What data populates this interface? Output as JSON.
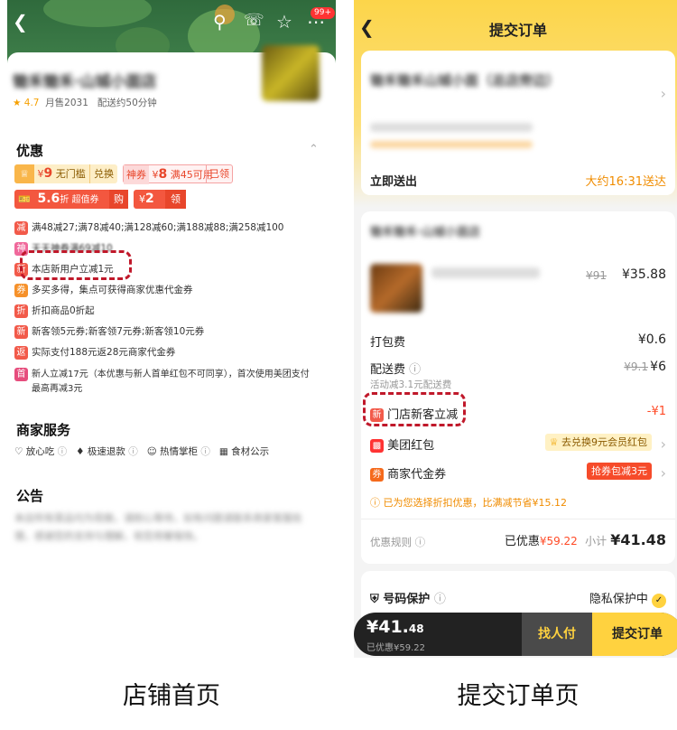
{
  "left": {
    "badge": "99+",
    "store_title": "锄禾锄禾·山城小面店",
    "rating": "4.7",
    "monthly_sales": "月售2031",
    "delivery_time": "配送约50分钟",
    "offers_title": "优惠",
    "coupon1_value": "9",
    "coupon1_desc": "无门槛",
    "coupon1_action": "兑换",
    "coupon2_tag": "神券",
    "coupon2_value": "8",
    "coupon2_desc": "满45可用",
    "coupon2_action": "已领",
    "coupon3_value": "5.6",
    "coupon3_desc": "折 超值券",
    "coupon3_action": "购",
    "coupon4_value": "2",
    "coupon4_action": "领",
    "currency": "¥",
    "offers": [
      {
        "icon": "减",
        "color": "#f25a4a",
        "text": "满48减27;满78减40;满128减60;满188减88;满258减100"
      },
      {
        "icon": "神",
        "color": "#f0689b",
        "text": "天天神券满69减10"
      },
      {
        "icon": "新",
        "color": "#f25a4a",
        "text": "本店新用户立减1元"
      },
      {
        "icon": "券",
        "color": "#f6912a",
        "text": "多买多得，集点可获得商家优惠代金券"
      },
      {
        "icon": "折",
        "color": "#f25a4a",
        "text": "折扣商品0折起"
      },
      {
        "icon": "新",
        "color": "#f25a4a",
        "text": "新客领5元券;新客领7元券;新客领10元券"
      },
      {
        "icon": "返",
        "color": "#f25a4a",
        "text": "实际支付188元返28元商家代金券"
      },
      {
        "icon": "首",
        "color": "#e64d7d",
        "text": "新人立减17元（本优惠与新人首单红包不可同享），首次使用美团支付"
      },
      {
        "icon": "",
        "color": "",
        "text": "最高再减3元"
      }
    ],
    "service_title": "商家服务",
    "services": [
      "放心吃",
      "极速退款",
      "热情掌柜",
      "食材公示"
    ],
    "notice_title": "公告",
    "notice_text": "本店所有菜品均为现做，请耐心等待，如有问题请联系商家客服处理，感谢您的支持与理解，祝您用餐愉快。",
    "caption": "店铺首页"
  },
  "right": {
    "title": "提交订单",
    "address_blur": "锄禾锄禾山城小面（总店旁边）",
    "send_now": "立即送出",
    "eta": "大约16:31送达",
    "store_blur": "锄禾锄禾·山城小面店",
    "item_old_price": "¥91",
    "item_price": "¥35.88",
    "packing_label": "打包费",
    "packing_price": "¥0.6",
    "delivery_label": "配送费",
    "delivery_old": "¥9.1",
    "delivery_price": "¥6",
    "delivery_note": "活动减3.1元配送费",
    "new_customer_icon": "新",
    "new_customer_label": "门店新客立减",
    "new_customer_value": "-¥1",
    "redpack_label": "美团红包",
    "redpack_action": "去兑换9元会员红包",
    "voucher_icon": "券",
    "voucher_label": "商家代金券",
    "voucher_action": "抢券包减3元",
    "tip": "已为您选择折扣优惠，比满减节省¥15.12",
    "rules_label": "优惠规则",
    "saved_label": "已优惠",
    "saved_value": "¥59.22",
    "subtotal_label": "小计",
    "subtotal_value": "¥41.48",
    "privacy_label": "号码保护",
    "privacy_status": "隐私保护中",
    "pay_main": "¥41.",
    "pay_cents": "48",
    "pay_saved": "已优惠¥59.22",
    "find_pay": "找人付",
    "submit": "提交订单",
    "caption": "提交订单页"
  },
  "colors": {
    "accent": "#ffd23f",
    "red": "#ff4a26",
    "annotation": "#c0182a"
  }
}
